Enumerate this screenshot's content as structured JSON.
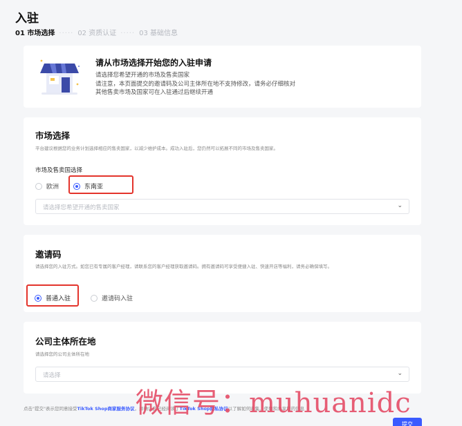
{
  "page": {
    "title": "入驻",
    "steps": [
      {
        "label": "01 市场选择",
        "active": true
      },
      {
        "label": "02 资质认证",
        "active": false
      },
      {
        "label": "03 基础信息",
        "active": false
      }
    ],
    "step_separator": "·····"
  },
  "intro": {
    "heading": "请从市场选择开始您的入驻申请",
    "lines": [
      "请选择您希望开通的市场及售卖国家",
      "请注意，本页面提交的邀请码及公司主体所在地不支持修改，请务必仔细核对",
      "其他售卖市场及国家可在入驻通过后继续开通"
    ],
    "icon": "shop-storefront-icon"
  },
  "market": {
    "title": "市场选择",
    "desc": "平台建议根据您的业务计划选择相应的售卖国家，以减少维护成本。成功入驻后，您仍然可以拓展不同的市场及售卖国家。",
    "field_label": "市场及售卖国选择",
    "options": [
      {
        "label": "欧洲",
        "checked": false
      },
      {
        "label": "东南亚",
        "checked": true
      }
    ],
    "country_placeholder": "请选择您希望开通的售卖国家"
  },
  "invite": {
    "title": "邀请码",
    "desc": "请选择您的入驻方式。如您已有专属的客户经理，请联系您的客户经理获取邀请码。拥有邀请码可享受便捷入驻、快速开店等福利，请务必确保填写。",
    "options": [
      {
        "label": "普通入驻",
        "checked": true
      },
      {
        "label": "邀请码入驻",
        "checked": false
      }
    ]
  },
  "company": {
    "title": "公司主体所在地",
    "desc": "请选择您的公司主体所在地",
    "placeholder": "请选择"
  },
  "footer": {
    "prefix": "点击\"提交\"表示您同意接受",
    "link1": "TikTok Shop商家服务协议",
    "middle": "，并确认您已经阅读了",
    "link2": "TikTok Shop隐私协议",
    "suffix": "以了解如何收集、使用和共享您的信息"
  },
  "submit_label": "提交",
  "watermark": "微信号：muhuanidc",
  "colors": {
    "accent": "#3a5bff",
    "highlight": "#e3332b",
    "watermark": "#e44862"
  }
}
